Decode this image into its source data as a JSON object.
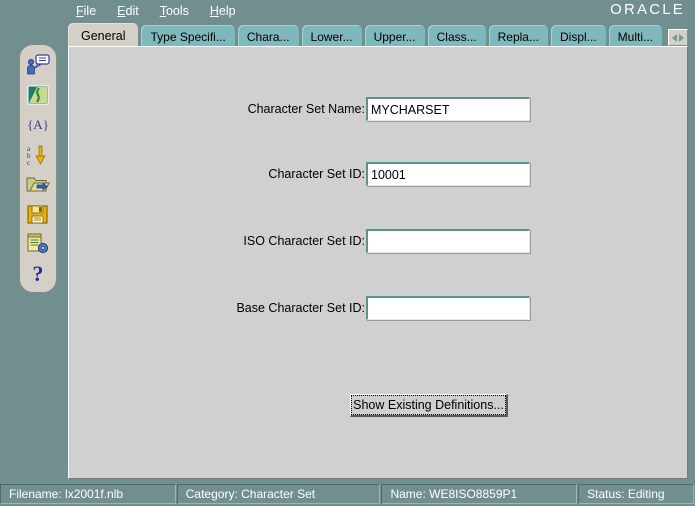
{
  "app": {
    "brand": "ORACLE",
    "background_color": "#728f90",
    "panel_color": "#d0d0d0",
    "tab_inactive_color": "#7eb8bc",
    "tab_active_color": "#d4d0c8"
  },
  "menubar": {
    "items": [
      {
        "label": "File",
        "mnemonic": "F",
        "rest": "ile"
      },
      {
        "label": "Edit",
        "mnemonic": "E",
        "rest": "dit"
      },
      {
        "label": "Tools",
        "mnemonic": "T",
        "rest": "ools"
      },
      {
        "label": "Help",
        "mnemonic": "H",
        "rest": "elp"
      }
    ]
  },
  "toolbar": {
    "icons": [
      {
        "name": "user-comment-icon",
        "title": "User Comment"
      },
      {
        "name": "map-image-icon",
        "title": "Map"
      },
      {
        "name": "braces-a-icon",
        "label": "{A}"
      },
      {
        "name": "sort-abc-icon",
        "title": "Sort"
      },
      {
        "name": "open-folder-icon",
        "title": "Open"
      },
      {
        "name": "save-floppy-icon",
        "title": "Save"
      },
      {
        "name": "document-gear-icon",
        "title": "Generate"
      },
      {
        "name": "help-question-icon",
        "label": "?"
      }
    ]
  },
  "tabs": {
    "items": [
      {
        "label": "General",
        "active": true
      },
      {
        "label": "Type Specifi...",
        "active": false
      },
      {
        "label": "Chara...",
        "active": false
      },
      {
        "label": "Lower...",
        "active": false
      },
      {
        "label": "Upper...",
        "active": false
      },
      {
        "label": "Class...",
        "active": false
      },
      {
        "label": "Repla...",
        "active": false
      },
      {
        "label": "Displ...",
        "active": false
      },
      {
        "label": "Multi...",
        "active": false
      }
    ],
    "scroll_button": "tab-scroll-arrows"
  },
  "form": {
    "fields": [
      {
        "label": "Character Set Name:",
        "value": "MYCHARSET",
        "placeholder": ""
      },
      {
        "label": "Character Set ID:",
        "value": "10001",
        "placeholder": ""
      },
      {
        "label": "ISO Character Set ID:",
        "value": "",
        "placeholder": ""
      },
      {
        "label": "Base Character Set ID:",
        "value": "",
        "placeholder": ""
      }
    ],
    "button": {
      "label": "Show Existing Definitions..."
    }
  },
  "statusbar": {
    "cells": [
      {
        "text": "Filename: lx2001f.nlb"
      },
      {
        "text": "Category: Character Set"
      },
      {
        "text": "Name: WE8ISO8859P1"
      },
      {
        "text": "Status: Editing"
      }
    ]
  }
}
